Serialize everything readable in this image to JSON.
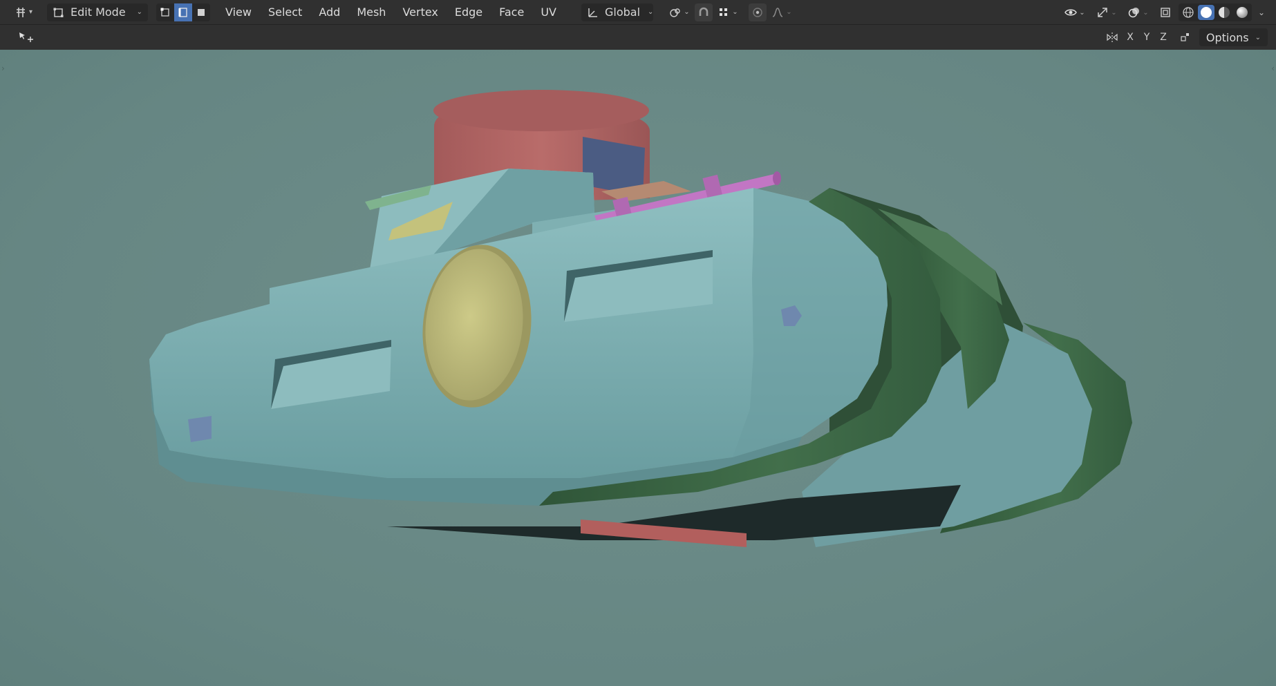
{
  "header": {
    "editor_type_icon": "viewport-icon",
    "mode_label": "Edit Mode",
    "select_modes": [
      {
        "name": "vertex-select",
        "active": false
      },
      {
        "name": "edge-select",
        "active": true
      },
      {
        "name": "face-select",
        "active": false
      }
    ],
    "menus": [
      "View",
      "Select",
      "Add",
      "Mesh",
      "Vertex",
      "Edge",
      "Face",
      "UV"
    ],
    "orientation_label": "Global"
  },
  "subheader": {
    "axes": [
      "X",
      "Y",
      "Z"
    ],
    "options_label": "Options"
  },
  "colors": {
    "header_bg": "#303030",
    "active_accent": "#4772b3",
    "viewport_bg": "#6a8a87",
    "hull": "#7fb0b2",
    "turret": "#a75f5e",
    "tracks": "#3f6b47",
    "gun": "#c276c4",
    "hatch": "#c4c27c",
    "window": "#4b5c83"
  }
}
